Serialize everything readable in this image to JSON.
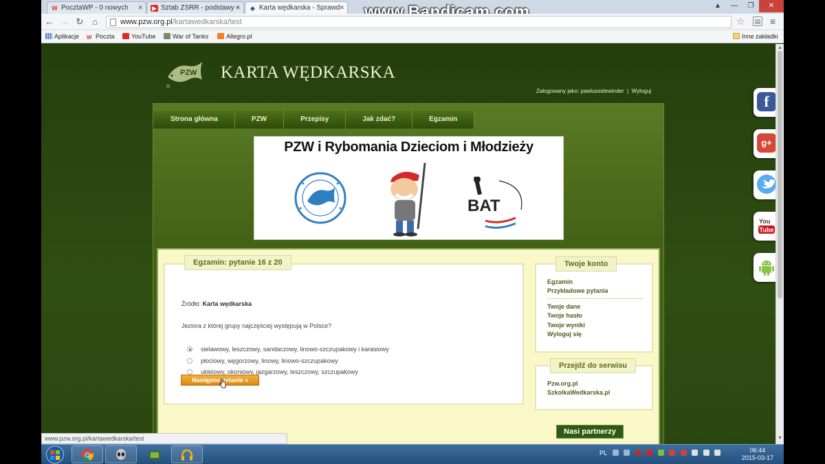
{
  "browser": {
    "tabs": [
      {
        "label": "PocztaWP - 0 nowych",
        "icon_color": "#d43d2a"
      },
      {
        "label": "Sztab ZSRR - podstawy -",
        "icon_color": "#e02b22"
      },
      {
        "label": "Karta wędkarska - Sprawd",
        "icon_color": "#3a4fa0"
      }
    ],
    "recording_watermark": "www.Bandicam.com",
    "address": {
      "host": "www.pzw.org.pl",
      "path": "/kartawedkarska/test"
    },
    "bookmarks": [
      "Aplikacje",
      "Poczta",
      "YouTube",
      "War of Tanks",
      "Allegro.pl"
    ],
    "other_bookmarks": "Inne zakładki",
    "status_url": "www.pzw.org.pl/kartawedkarska/test"
  },
  "site": {
    "title": "KARTA WĘDKARSKA",
    "login_label": "Zalogowany jako:",
    "login_user": "pawlussidewinder",
    "logout": "Wyloguj",
    "nav": [
      "Strona główna",
      "PZW",
      "Przepisy",
      "Jak zdać?",
      "Egzamin"
    ],
    "banner_title": "PZW i Rybomania Dzieciom i Młodzieży"
  },
  "exam": {
    "heading": "Egzamin: pytanie 16 z 20",
    "source_label": "Źródło:",
    "source_value": "Karta wędkarska",
    "question": "Jeziora z której grupy najczęściej występują w Polsce?",
    "answers": [
      {
        "text": "sielawowy, leszczowy, sandaczowy, linowo-szczupakowy i karasiowy",
        "selected": true
      },
      {
        "text": "płociowy, węgorzowy, linowy, linowo-szczupakowy",
        "selected": false
      },
      {
        "text": "ukleiowy, okoniowy, jazgarzowy, leszczowy, szczupakowy",
        "selected": false
      }
    ],
    "next_button": "Następne pytanie »"
  },
  "sidebar": {
    "account_title": "Twoje konto",
    "account_links_1": [
      "Egzamin",
      "Przykładowe pytania"
    ],
    "account_links_2": [
      "Twoje dane",
      "Twoje hasło",
      "Twoje wyniki",
      "Wyloguj się"
    ],
    "service_title": "Przejdź do serwisu",
    "service_links": [
      "Pzw.org.pl",
      "SzkolkaWedkarska.pl"
    ],
    "partners_title": "Nasi partnerzy"
  },
  "social": [
    {
      "name": "facebook",
      "glyph": "f",
      "color": "#3b5998"
    },
    {
      "name": "google-plus",
      "glyph": "g+",
      "color": "#d34836"
    },
    {
      "name": "twitter",
      "glyph": "🐦",
      "color": "#55acee"
    },
    {
      "name": "youtube",
      "glyph": "You\nTube",
      "color": "#cc181e"
    },
    {
      "name": "android",
      "glyph": "🤖",
      "color": "#8bc34a"
    }
  ],
  "taskbar": {
    "lang": "PL",
    "time": "06:44",
    "date": "2015-03-17"
  }
}
